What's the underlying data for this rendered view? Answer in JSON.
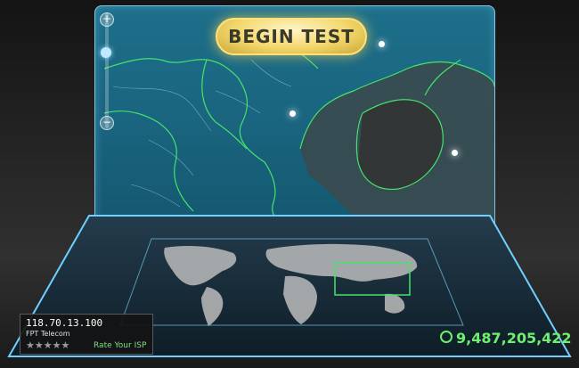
{
  "toolbar": {
    "begin_label": "BEGIN TEST"
  },
  "zoom": {
    "plus_label": "+",
    "minus_label": "−"
  },
  "connection": {
    "ip": "118.70.13.100",
    "isp": "FPT Telecom",
    "stars": "★★★★★",
    "rate_label": "Rate Your ISP"
  },
  "stats": {
    "total_tests": "9,487,205,422"
  },
  "colors": {
    "accent": "#6ef06e",
    "button": "#f3d66b",
    "glass": "#1d6f8a"
  },
  "icons": [
    "plus-icon",
    "minus-icon",
    "globe-icon",
    "star-icon"
  ]
}
